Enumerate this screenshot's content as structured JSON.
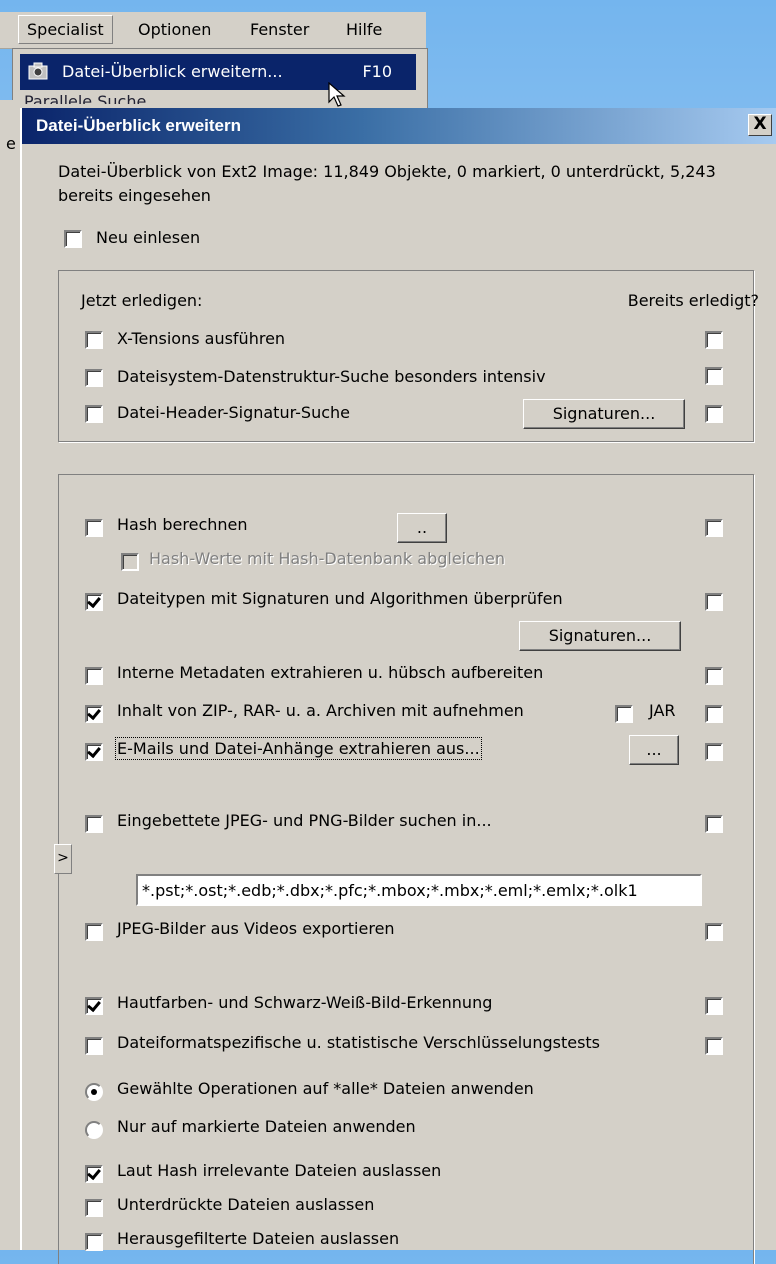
{
  "menubar": {
    "items": [
      "Specialist",
      "Optionen",
      "Fenster",
      "Hilfe"
    ]
  },
  "popup": {
    "highlighted_label": "Datei-Überblick erweitern...",
    "highlighted_shortcut": "F10",
    "next_item_fragment": "Parallele Suche",
    "left_fragment": "e"
  },
  "dialog": {
    "title": "Datei-Überblick erweitern",
    "close_label": "X",
    "summary": "Datei-Überblick von Ext2 Image: 11,849 Objekte, 0 markiert, 0 unterdrückt, 5,243 bereits eingesehen",
    "reload_label": "Neu einlesen",
    "group1": {
      "header_left": "Jetzt erledigen:",
      "header_right": "Bereits erledigt?",
      "items": [
        {
          "label": "X-Tensions ausführen",
          "checked": false,
          "done": false
        },
        {
          "label": "Dateisystem-Datenstruktur-Suche besonders intensiv",
          "checked": false,
          "done": false
        },
        {
          "label": "Datei-Header-Signatur-Suche",
          "checked": false,
          "done": false,
          "button": "Signaturen..."
        }
      ]
    },
    "group2": {
      "hash_label": "Hash berechnen",
      "hash_button": "..",
      "hash_db_label": "Hash-Werte mit Hash-Datenbank abgleichen",
      "filetype_label": "Dateitypen mit Signaturen und Algorithmen überprüfen",
      "filetype_button": "Signaturen...",
      "metadata_label": "Interne Metadaten extrahieren u. hübsch aufbereiten",
      "archive_label": "Inhalt von ZIP-, RAR- u. a. Archiven mit aufnehmen",
      "jar_label": "JAR",
      "email_label": "E-Mails und Datei-Anhänge extrahieren aus...",
      "email_button": "...",
      "email_extensions": "*.pst;*.ost;*.edb;*.dbx;*.pfc;*.mbox;*.mbx;*.eml;*.emlx;*.olk1",
      "embedded_label": "Eingebettete JPEG- und PNG-Bilder suchen in...",
      "video_label": "JPEG-Bilder aus Videos exportieren",
      "skin_label": "Hautfarben- und Schwarz-Weiß-Bild-Erkennung",
      "encryption_label": "Dateiformatspezifische u. statistische Verschlüsselungstests",
      "radio_all": "Gewählte Operationen auf *alle* Dateien anwenden",
      "radio_marked": "Nur auf markierte Dateien anwenden",
      "skip_hash_label": "Laut Hash irrelevante Dateien auslassen",
      "skip_suppressed_label": "Unterdrückte Dateien auslassen",
      "skip_filtered_label": "Herausgefilterte Dateien auslassen",
      "expander_glyph": ">"
    }
  }
}
